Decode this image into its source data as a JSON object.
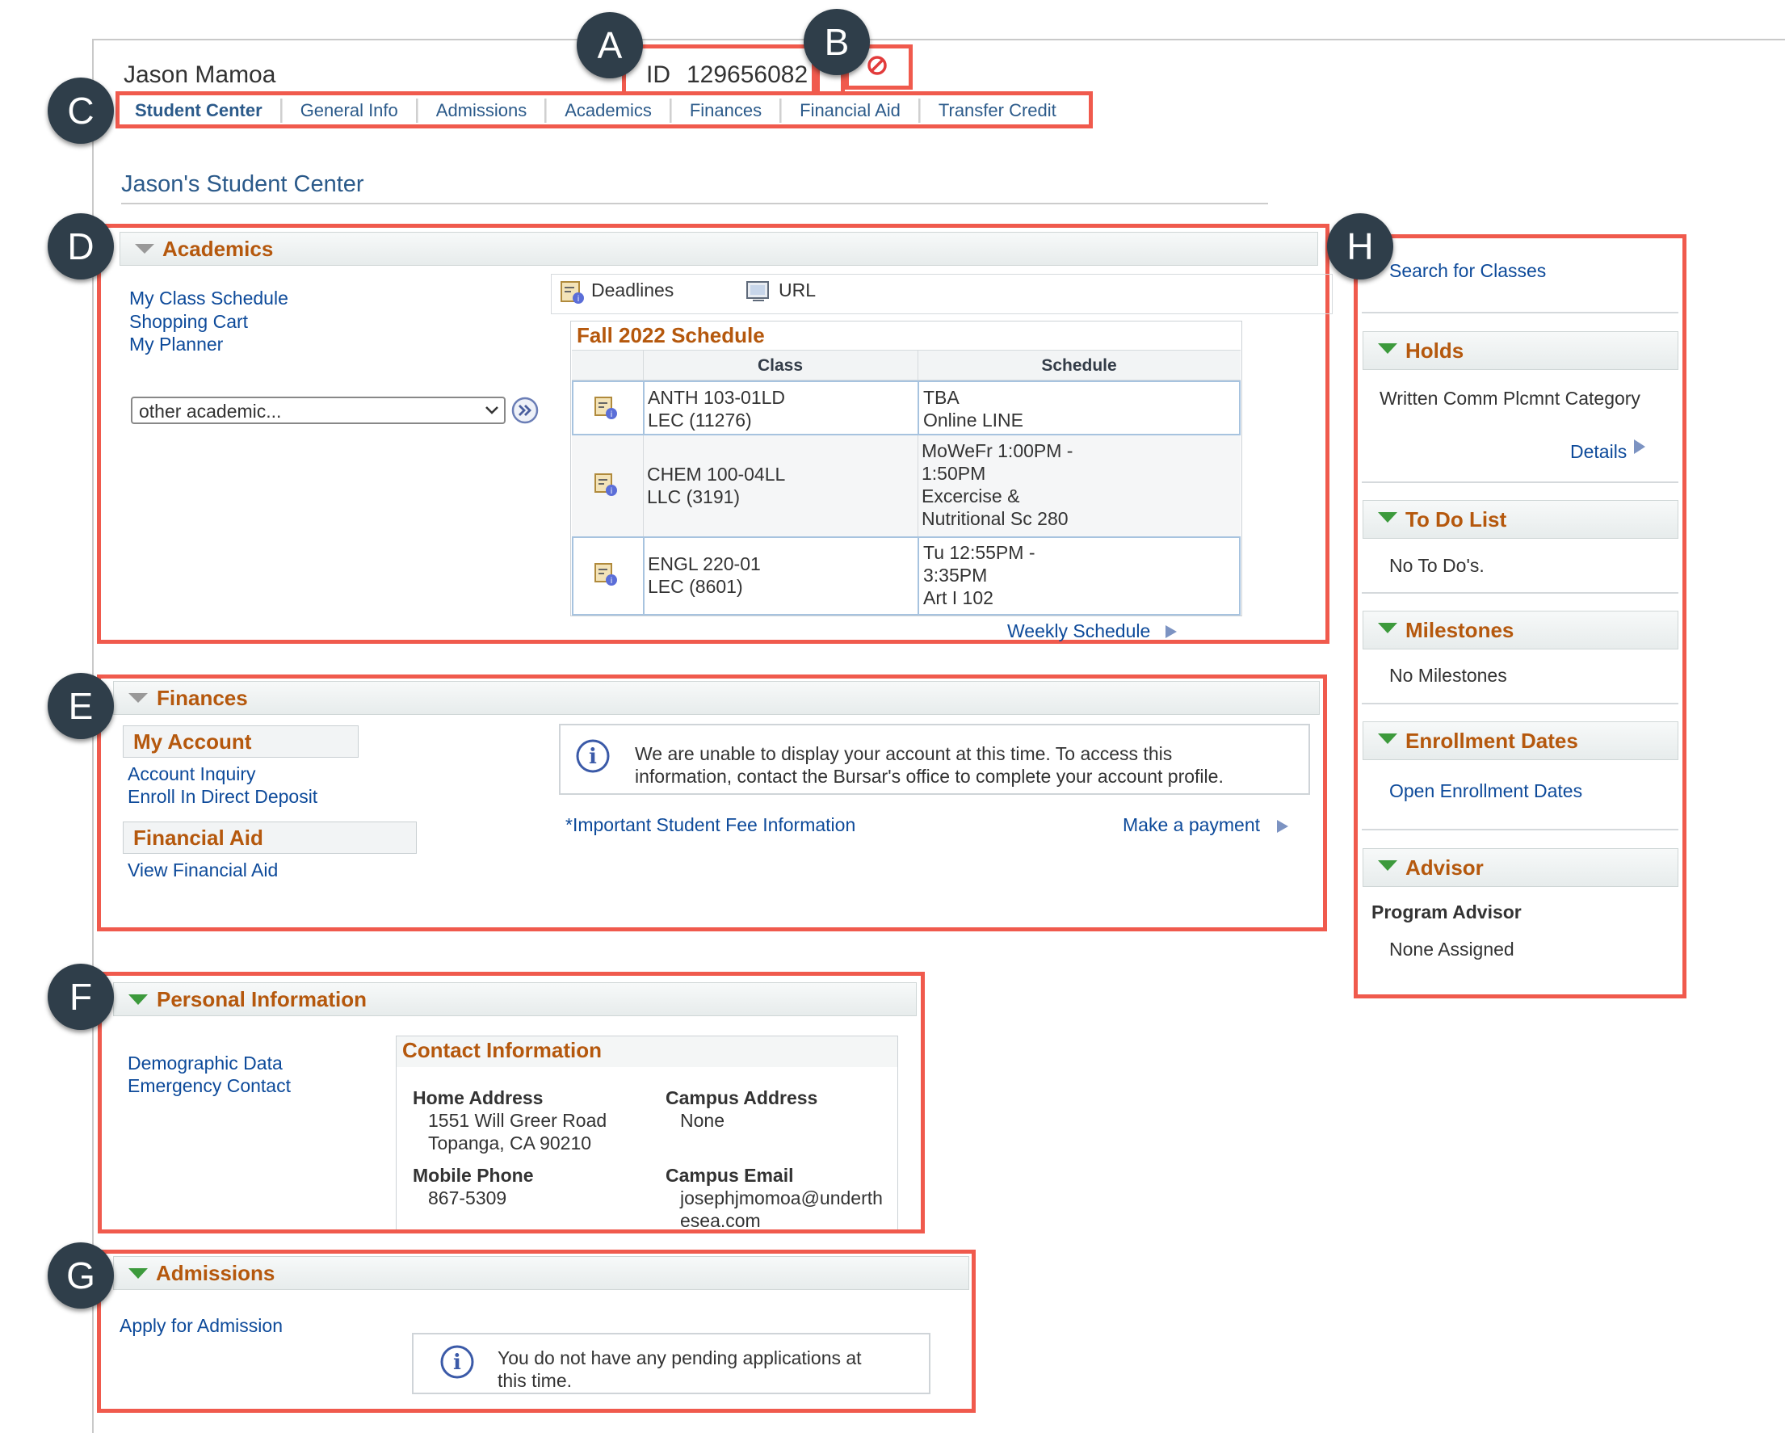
{
  "header": {
    "student_name": "Jason Mamoa",
    "id_label": "ID",
    "id_value": "129656082"
  },
  "badges": [
    "A",
    "B",
    "C",
    "D",
    "E",
    "F",
    "G",
    "H"
  ],
  "tabs": [
    {
      "label": "Student Center",
      "active": true
    },
    {
      "label": "General Info"
    },
    {
      "label": "Admissions"
    },
    {
      "label": "Academics"
    },
    {
      "label": "Finances"
    },
    {
      "label": "Financial Aid"
    },
    {
      "label": "Transfer Credit"
    }
  ],
  "page_title": "Jason's Student Center",
  "academics": {
    "title": "Academics",
    "links": [
      "My Class Schedule",
      "Shopping Cart",
      "My Planner"
    ],
    "select_value": "other academic...",
    "tools": [
      "Deadlines",
      "URL"
    ],
    "schedule_title": "Fall 2022 Schedule",
    "columns": [
      "Class",
      "Schedule"
    ],
    "rows": [
      {
        "class": [
          "ANTH 103-01LD",
          "LEC (11276)"
        ],
        "schedule": [
          "TBA",
          "Online LINE"
        ]
      },
      {
        "class": [
          "CHEM 100-04LL",
          "LLC (3191)"
        ],
        "schedule": [
          "MoWeFr 1:00PM -",
          "1:50PM",
          "Excercise &",
          "Nutritional Sc 280"
        ]
      },
      {
        "class": [
          "ENGL 220-01",
          "LEC (8601)"
        ],
        "schedule": [
          "Tu 12:55PM -",
          "3:35PM",
          "Art I 102"
        ]
      }
    ],
    "weekly_link": "Weekly Schedule"
  },
  "finances": {
    "title": "Finances",
    "my_account": "My Account",
    "account_links": [
      "Account Inquiry",
      "Enroll In Direct Deposit"
    ],
    "financial_aid": "Financial Aid",
    "aid_links": [
      "View Financial Aid"
    ],
    "notice_line1": "We are unable to display your account at this time.  To access this",
    "notice_line2": "information, contact the Bursar's office to complete your account profile.",
    "fee_link": "*Important Student Fee Information",
    "payment_link": "Make a payment"
  },
  "personal": {
    "title": "Personal Information",
    "links": [
      "Demographic Data",
      "Emergency Contact"
    ],
    "contact_title": "Contact Information",
    "home_address_label": "Home Address",
    "home_address": [
      "1551 Will Greer Road",
      "Topanga, CA 90210"
    ],
    "campus_address_label": "Campus Address",
    "campus_address": "None",
    "mobile_label": "Mobile Phone",
    "mobile": "867-5309",
    "email_label": "Campus Email",
    "email": [
      "josephjmomoa@underth",
      "esea.com"
    ]
  },
  "admissions": {
    "title": "Admissions",
    "link": "Apply for Admission",
    "notice_line1": "You do not have any pending applications at",
    "notice_line2": "this time."
  },
  "sidebar": {
    "search_link": "Search for Classes",
    "holds_title": "Holds",
    "holds_item": "Written Comm Plcmnt Category",
    "details_link": "Details",
    "todo_title": "To Do List",
    "todo_text": "No To Do's.",
    "milestones_title": "Milestones",
    "milestones_text": "No Milestones",
    "enrollment_title": "Enrollment Dates",
    "enrollment_link": "Open Enrollment Dates",
    "advisor_title": "Advisor",
    "advisor_label": "Program Advisor",
    "advisor_text": "None Assigned"
  },
  "colors": {
    "accent_red": "#f05a4d",
    "link_blue": "#0d4a9a",
    "section_orange": "#b5580d",
    "badge_dark": "#2f3e4a"
  }
}
